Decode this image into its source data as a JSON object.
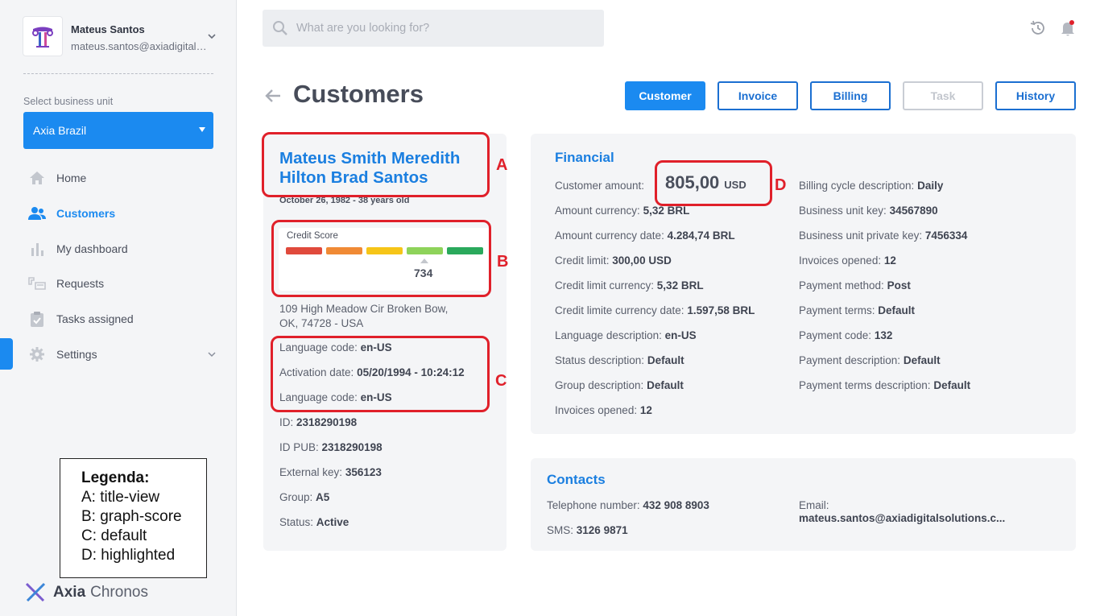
{
  "user": {
    "name": "Mateus Santos",
    "email": "mateus.santos@axiadigitalsolutions.com"
  },
  "business_unit": {
    "label": "Select business unit",
    "selected": "Axia Brazil"
  },
  "nav": {
    "items": [
      {
        "label": "Home",
        "icon": "home-icon"
      },
      {
        "label": "Customers",
        "icon": "users-icon",
        "active": true
      },
      {
        "label": "My dashboard",
        "icon": "bar-chart-icon"
      },
      {
        "label": "Requests",
        "icon": "requests-icon"
      },
      {
        "label": "Tasks assigned",
        "icon": "clipboard-check-icon"
      },
      {
        "label": "Settings",
        "icon": "gear-icon"
      }
    ]
  },
  "legend": {
    "title": "Legenda:",
    "items": [
      "A: title-view",
      "B: graph-score",
      "C: default",
      "D: highlighted"
    ]
  },
  "brand": {
    "name_bold": "Axia",
    "name_rest": "Chronos"
  },
  "search": {
    "placeholder": "What are you looking for?"
  },
  "header": {
    "title": "Customers",
    "tabs": [
      {
        "label": "Customer",
        "state": "active"
      },
      {
        "label": "Invoice",
        "state": "normal"
      },
      {
        "label": "Billing",
        "state": "normal"
      },
      {
        "label": "Task",
        "state": "disabled"
      },
      {
        "label": "History",
        "state": "normal"
      }
    ]
  },
  "customer": {
    "name": "Mateus Smith Meredith Hilton Brad Santos",
    "dob": "October 26, 1982 - 38 years old",
    "credit_score": {
      "label": "Credit Score",
      "value": "734",
      "colors": [
        "#e04a3c",
        "#f08a35",
        "#f6c518",
        "#8ed35a",
        "#2aa95c"
      ]
    },
    "address_line1": "109 High Meadow Cir Broken Bow,",
    "address_line2": "OK, 74728 - USA",
    "details": [
      {
        "label": "Language code:",
        "value": "en-US"
      },
      {
        "label": "Activation date:",
        "value": "05/20/1994 - 10:24:12"
      },
      {
        "label": "Language code:",
        "value": "en-US"
      },
      {
        "label": "ID:",
        "value": "2318290198"
      },
      {
        "label": "ID PUB:",
        "value": "2318290198"
      },
      {
        "label": "External key:",
        "value": "356123"
      },
      {
        "label": "Group:",
        "value": "A5"
      },
      {
        "label": "Status:",
        "value": "Active"
      }
    ]
  },
  "financial": {
    "title": "Financial",
    "amount_label": "Customer amount:",
    "amount_value": "805,00",
    "amount_currency": "USD",
    "left": [
      {
        "label": "Amount currency:",
        "value": "5,32 BRL"
      },
      {
        "label": "Amount currency date:",
        "value": "4.284,74 BRL"
      },
      {
        "label": "Credit limit:",
        "value": "300,00 USD"
      },
      {
        "label": "Credit limit currency:",
        "value": "5,32 BRL"
      },
      {
        "label": "Credit limite currency date:",
        "value": "1.597,58 BRL"
      },
      {
        "label": "Language description:",
        "value": "en-US"
      },
      {
        "label": "Status description:",
        "value": "Default"
      },
      {
        "label": "Group description:",
        "value": "Default"
      },
      {
        "label": "Invoices opened:",
        "value": "12"
      }
    ],
    "right": [
      {
        "label": "Billing cycle description:",
        "value": "Daily"
      },
      {
        "label": "Business unit key:",
        "value": "34567890"
      },
      {
        "label": "Business unit private key:",
        "value": "7456334"
      },
      {
        "label": "Invoices opened:",
        "value": "12"
      },
      {
        "label": "Payment method:",
        "value": "Post"
      },
      {
        "label": "Payment terms:",
        "value": "Default"
      },
      {
        "label": "Payment code:",
        "value": "132"
      },
      {
        "label": "Payment description:",
        "value": "Default"
      },
      {
        "label": "Payment terms description:",
        "value": "Default"
      }
    ]
  },
  "contacts": {
    "title": "Contacts",
    "telephone_label": "Telephone number:",
    "telephone_value": "432 908 8903",
    "sms_label": "SMS:",
    "sms_value": "3126 9871",
    "email_label": "Email:",
    "email_value": "mateus.santos@axiadigitalsolutions.c..."
  },
  "annotations": [
    "A",
    "B",
    "C",
    "D"
  ],
  "colors": {
    "accent": "#1b8af0",
    "title_blue": "#1b7fe0",
    "annotation_red": "#e0202a"
  }
}
